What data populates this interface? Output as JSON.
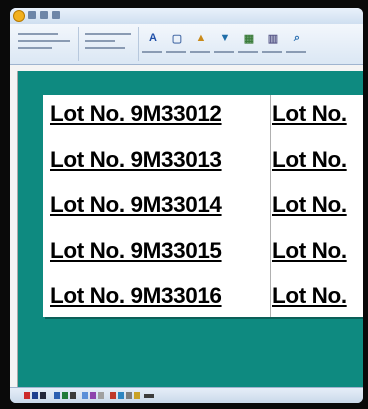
{
  "window": {
    "accent_color": "#0e8a80",
    "app_icon": "app-logo-icon"
  },
  "ribbon": {
    "tools": [
      {
        "name": "text-tool-icon",
        "glyph": "A"
      },
      {
        "name": "frame-tool-icon",
        "glyph": "▢"
      },
      {
        "name": "image-tool-icon",
        "glyph": "▲"
      },
      {
        "name": "fill-tool-icon",
        "glyph": "▼"
      },
      {
        "name": "table-tool-icon",
        "glyph": "▦"
      },
      {
        "name": "barcode-tool-icon",
        "glyph": "▥"
      },
      {
        "name": "zoom-tool-icon",
        "glyph": "⌕"
      }
    ]
  },
  "labels": {
    "rows": [
      {
        "left": "Lot No. 9M33012",
        "right": "Lot No."
      },
      {
        "left": "Lot No. 9M33013",
        "right": "Lot No."
      },
      {
        "left": "Lot No. 9M33014",
        "right": "Lot No."
      },
      {
        "left": "Lot No. 9M33015",
        "right": "Lot No."
      },
      {
        "left": "Lot No. 9M33016",
        "right": "Lot No."
      }
    ]
  }
}
